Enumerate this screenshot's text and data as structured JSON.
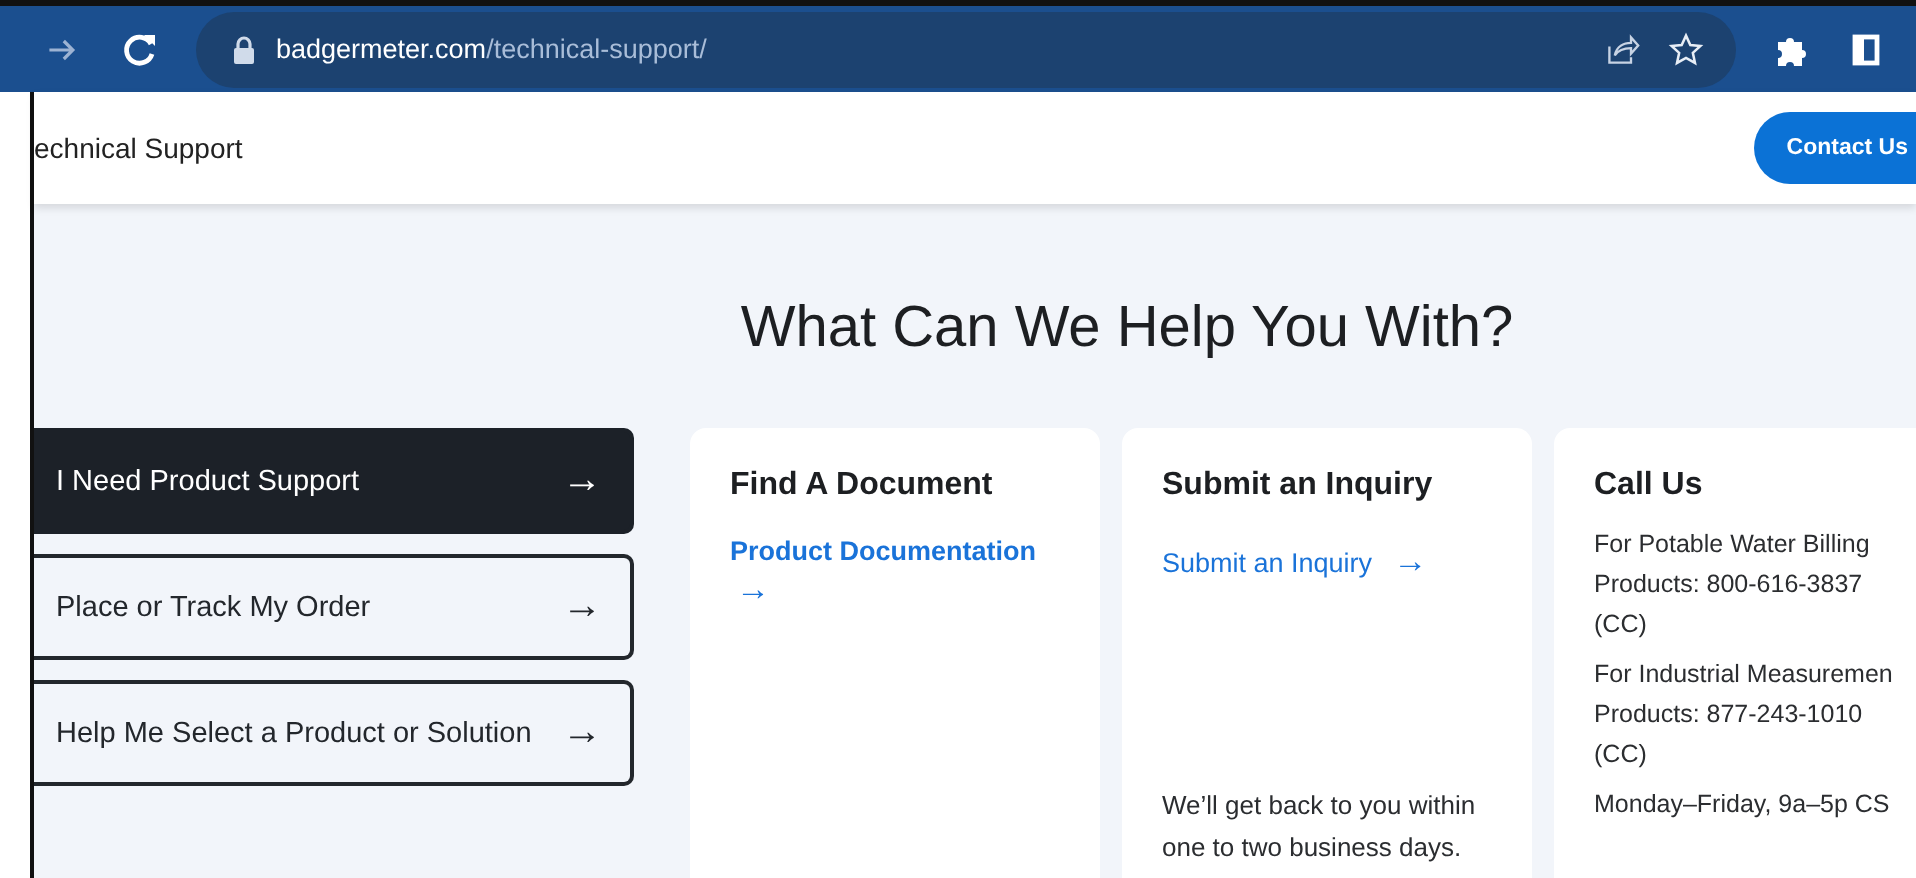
{
  "browser": {
    "url_host": "badgermeter.com",
    "url_path": "/technical-support/"
  },
  "header": {
    "title": "echnical Support",
    "contact_button": "Contact Us"
  },
  "heading": "What Can We Help You With?",
  "options": [
    {
      "label": "I Need Product Support",
      "arrow": "→",
      "selected": true
    },
    {
      "label": "Place or Track My Order",
      "arrow": "→",
      "selected": false
    },
    {
      "label": "Help Me Select a Product or Solution",
      "arrow": "→",
      "selected": false
    }
  ],
  "cards": [
    {
      "kind": "links",
      "title": "Find A Document",
      "link": "Product Documentation",
      "arrow": "→"
    },
    {
      "kind": "inquiry",
      "title": "Submit an Inquiry",
      "link": "Submit an Inquiry",
      "arrow": "→",
      "note": "We’ll get back to you within one to two business days."
    },
    {
      "kind": "phones",
      "title": "Call Us",
      "paragraphs": [
        [
          "For Potable Water Billing",
          "Products: 800-616-3837",
          "(CC)"
        ],
        [
          "For Industrial Measuremen",
          "Products: 877-243-1010",
          "(CC)"
        ],
        [
          "Monday–Friday, 9a–5p CS"
        ]
      ]
    }
  ]
}
